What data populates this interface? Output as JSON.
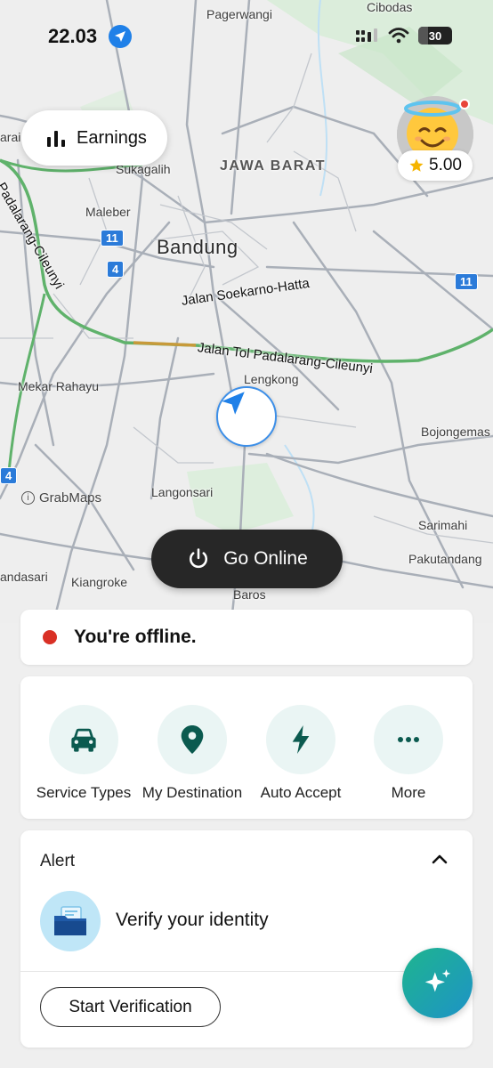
{
  "status_bar": {
    "time": "22.03",
    "battery": "30"
  },
  "map": {
    "labels": {
      "pagerwangi": "Pagerwangi",
      "cibodas": "Cibodas",
      "sukagalih": "Sukagalih",
      "jawa_barat": "JAWA BARAT",
      "maleber": "Maleber",
      "bandung": "Bandung",
      "mekar_rahayu": "Mekar Rahayu",
      "lengkong": "Lengkong",
      "bojongemas": "Bojongemas",
      "langonsari": "Langonsari",
      "sarimahi": "Sarimahi",
      "pakutandang": "Pakutandang",
      "andasari": "andasari",
      "kiangroke": "Kiangroke",
      "baros": "Baros",
      "arai": "arai",
      "soekarno_hatta": "Jalan Soekarno-Hatta",
      "tol_padalarang": "Jalan Tol Padalarang-Cileunyi",
      "padalarang_cileunyi": "Padalarang-Cileunyi"
    },
    "shields": {
      "a": "11",
      "b": "4",
      "c": "11",
      "d": "4"
    },
    "attribution": "GrabMaps"
  },
  "earnings": {
    "label": "Earnings"
  },
  "profile": {
    "rating": "5.00"
  },
  "go_online": {
    "label": "Go Online"
  },
  "offline": {
    "text": "You're offline."
  },
  "actions": [
    {
      "label": "Service Types",
      "icon": "car-icon"
    },
    {
      "label": "My Destination",
      "icon": "location-pin-icon"
    },
    {
      "label": "Auto Accept",
      "icon": "lightning-icon"
    },
    {
      "label": "More",
      "icon": "more-dots-icon"
    }
  ],
  "alert": {
    "title": "Alert",
    "verify_text": "Verify your identity",
    "button_label": "Start Verification"
  },
  "colors": {
    "accent_teal": "#0b5a4f",
    "offline_red": "#d93025",
    "nav_blue": "#1f80e8"
  }
}
